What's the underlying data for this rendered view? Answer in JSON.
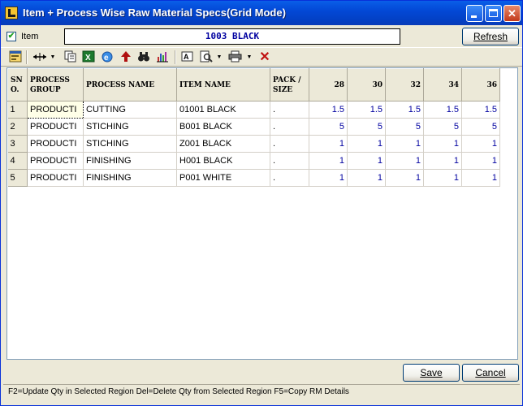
{
  "window": {
    "title": "Item + Process Wise Raw Material Specs(Grid Mode)",
    "controls": {
      "minimize": "",
      "maximize": "",
      "close": "✕"
    }
  },
  "item_filter": {
    "checkbox_label": "Item",
    "checked": true,
    "value": "1003 BLACK",
    "refresh_label": "Refresh"
  },
  "toolbar": {
    "icons": [
      "form-icon",
      "resize-columns-icon",
      "dropdown-icon",
      "copy-icon",
      "excel-icon",
      "browser-icon",
      "up-arrow-icon",
      "binoculars-icon",
      "chart-icon",
      "font-icon",
      "print-preview-icon",
      "dropdown-icon",
      "printer-icon",
      "dropdown-icon",
      "delete-icon"
    ]
  },
  "grid": {
    "headers": {
      "sno": "SN O.",
      "process_group": "PROCESS GROUP",
      "process_name": "PROCESS NAME",
      "item_name": "ITEM NAME",
      "pack_size": "PACK / SIZE",
      "s28": "28",
      "s30": "30",
      "s32": "32",
      "s34": "34",
      "s36": "36"
    },
    "rows": [
      {
        "sno": "1",
        "process_group": "PRODUCTI",
        "process_name": "CUTTING",
        "item_name": "01001 BLACK",
        "pack_size": ".",
        "s28": "1.5",
        "s30": "1.5",
        "s32": "1.5",
        "s34": "1.5",
        "s36": "1.5"
      },
      {
        "sno": "2",
        "process_group": "PRODUCTI",
        "process_name": "STICHING",
        "item_name": "B001 BLACK",
        "pack_size": ".",
        "s28": "5",
        "s30": "5",
        "s32": "5",
        "s34": "5",
        "s36": "5"
      },
      {
        "sno": "3",
        "process_group": "PRODUCTI",
        "process_name": "STICHING",
        "item_name": "Z001 BLACK",
        "pack_size": ".",
        "s28": "1",
        "s30": "1",
        "s32": "1",
        "s34": "1",
        "s36": "1"
      },
      {
        "sno": "4",
        "process_group": "PRODUCTI",
        "process_name": "FINISHING",
        "item_name": "H001 BLACK",
        "pack_size": ".",
        "s28": "1",
        "s30": "1",
        "s32": "1",
        "s34": "1",
        "s36": "1"
      },
      {
        "sno": "5",
        "process_group": "PRODUCTI",
        "process_name": "FINISHING",
        "item_name": "P001 WHITE",
        "pack_size": ".",
        "s28": "1",
        "s30": "1",
        "s32": "1",
        "s34": "1",
        "s36": "1"
      }
    ]
  },
  "buttons": {
    "save": "Save",
    "cancel": "Cancel"
  },
  "status": "F2=Update Qty in Selected Region   Del=Delete Qty from Selected Region   F5=Copy RM Details",
  "colors": {
    "title_bar": "#0348d6",
    "numeric_text": "#0000a0",
    "item_text": "#0000a0"
  }
}
